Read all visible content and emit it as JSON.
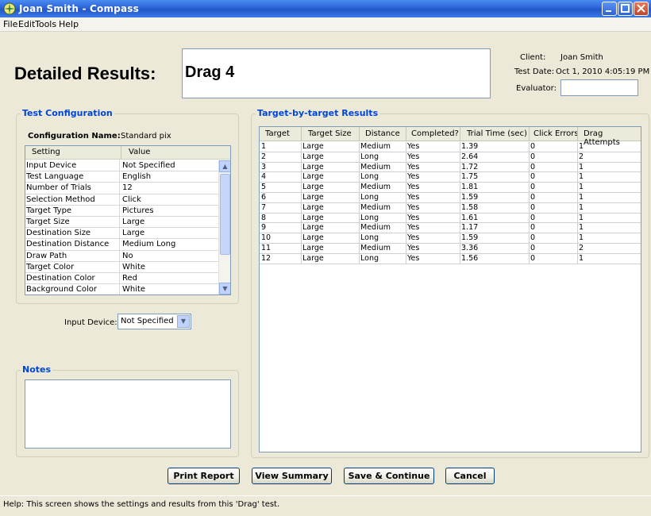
{
  "window": {
    "title": "Joan Smith - Compass",
    "colors": {
      "titlebar": "#2b63d8",
      "group_title": "#0046d5",
      "background": "#ece9d8"
    }
  },
  "menu": [
    "File",
    "Edit",
    "Tools",
    "Help"
  ],
  "header": {
    "heading": "Detailed Results:",
    "test_name": "Drag 4",
    "client_label": "Client:",
    "client_value": "Joan Smith",
    "test_date_label": "Test Date:",
    "test_date_value": "Oct 1, 2010 4:05:19 PM",
    "evaluator_label": "Evaluator:",
    "evaluator_value": ""
  },
  "config": {
    "group_title": "Test Configuration",
    "name_label": "Configuration Name:",
    "name_value": "Standard pix",
    "columns": [
      "Setting",
      "Value"
    ],
    "rows": [
      [
        "Input Device",
        "Not Specified"
      ],
      [
        "Test Language",
        "English"
      ],
      [
        "Number of Trials",
        "12"
      ],
      [
        "Selection Method",
        "Click"
      ],
      [
        "Target Type",
        "Pictures"
      ],
      [
        "Target Size",
        "Large"
      ],
      [
        "Destination Size",
        "Large"
      ],
      [
        "Destination Distance",
        "Medium Long"
      ],
      [
        "Draw Path",
        "No"
      ],
      [
        "Target Color",
        "White"
      ],
      [
        "Destination Color",
        "Red"
      ],
      [
        "Background Color",
        "White"
      ]
    ],
    "input_device_label": "Input Device:",
    "input_device_value": "Not Specified"
  },
  "notes": {
    "group_title": "Notes",
    "value": ""
  },
  "results": {
    "group_title": "Target-by-target Results",
    "columns": [
      "Target",
      "Target Size",
      "Distance",
      "Completed?",
      "Trial Time (sec)",
      "Click Errors",
      "Drag Attempts"
    ],
    "rows": [
      [
        "1",
        "Large",
        "Medium",
        "Yes",
        "1.39",
        "0",
        "1"
      ],
      [
        "2",
        "Large",
        "Long",
        "Yes",
        "2.64",
        "0",
        "2"
      ],
      [
        "3",
        "Large",
        "Medium",
        "Yes",
        "1.72",
        "0",
        "1"
      ],
      [
        "4",
        "Large",
        "Long",
        "Yes",
        "1.75",
        "0",
        "1"
      ],
      [
        "5",
        "Large",
        "Medium",
        "Yes",
        "1.81",
        "0",
        "1"
      ],
      [
        "6",
        "Large",
        "Long",
        "Yes",
        "1.59",
        "0",
        "1"
      ],
      [
        "7",
        "Large",
        "Medium",
        "Yes",
        "1.58",
        "0",
        "1"
      ],
      [
        "8",
        "Large",
        "Long",
        "Yes",
        "1.61",
        "0",
        "1"
      ],
      [
        "9",
        "Large",
        "Medium",
        "Yes",
        "1.17",
        "0",
        "1"
      ],
      [
        "10",
        "Large",
        "Long",
        "Yes",
        "1.59",
        "0",
        "1"
      ],
      [
        "11",
        "Large",
        "Medium",
        "Yes",
        "3.36",
        "0",
        "2"
      ],
      [
        "12",
        "Large",
        "Long",
        "Yes",
        "1.56",
        "0",
        "1"
      ]
    ]
  },
  "buttons": {
    "print_report": "Print Report",
    "view_summary": "View Summary",
    "save_continue": "Save & Continue",
    "cancel": "Cancel"
  },
  "status": "Help:  This screen shows the settings and results from this 'Drag' test."
}
